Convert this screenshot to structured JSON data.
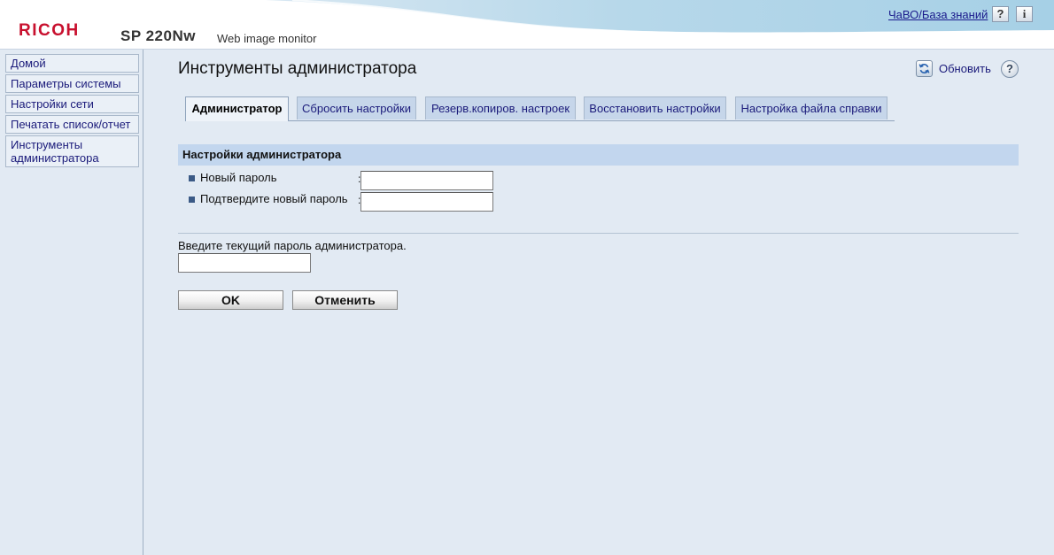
{
  "header": {
    "brand": "RICOH",
    "model": "SP 220Nw",
    "app_name": "Web image monitor",
    "faq_link": "ЧаВО/База знаний",
    "help_button": "?",
    "info_button": "i"
  },
  "sidebar": {
    "items": [
      {
        "label": "Домой"
      },
      {
        "label": "Параметры системы"
      },
      {
        "label": "Настройки сети"
      },
      {
        "label": "Печатать список/отчет"
      },
      {
        "label": "Инструменты администратора"
      }
    ]
  },
  "main": {
    "title": "Инструменты администратора",
    "refresh_label": "Обновить",
    "help_icon": "?",
    "tabs": [
      {
        "label": "Администратор",
        "active": true
      },
      {
        "label": "Сбросить настройки",
        "active": false
      },
      {
        "label": "Резерв.копиров. настроек",
        "active": false
      },
      {
        "label": "Восстановить настройки",
        "active": false
      },
      {
        "label": "Настройка файла справки",
        "active": false
      }
    ],
    "section_title": "Настройки администратора",
    "fields": [
      {
        "label": "Новый пароль",
        "colon": ":",
        "value": ""
      },
      {
        "label": "Подтвердите новый пароль",
        "colon": ":",
        "value": ""
      }
    ],
    "current_password_label": "Введите текущий пароль администратора.",
    "current_password_value": "",
    "ok_button": "OK",
    "cancel_button": "Отменить"
  },
  "colors": {
    "brand_red": "#c8102e",
    "background": "#e2eaf3",
    "tab_inactive": "#c6d6ea",
    "section_header": "#c2d6ee",
    "link": "#1a1a8c"
  },
  "icons": {
    "refresh": "refresh-icon",
    "help": "help-icon",
    "info": "info-icon",
    "bullet": "square-bullet-icon"
  }
}
